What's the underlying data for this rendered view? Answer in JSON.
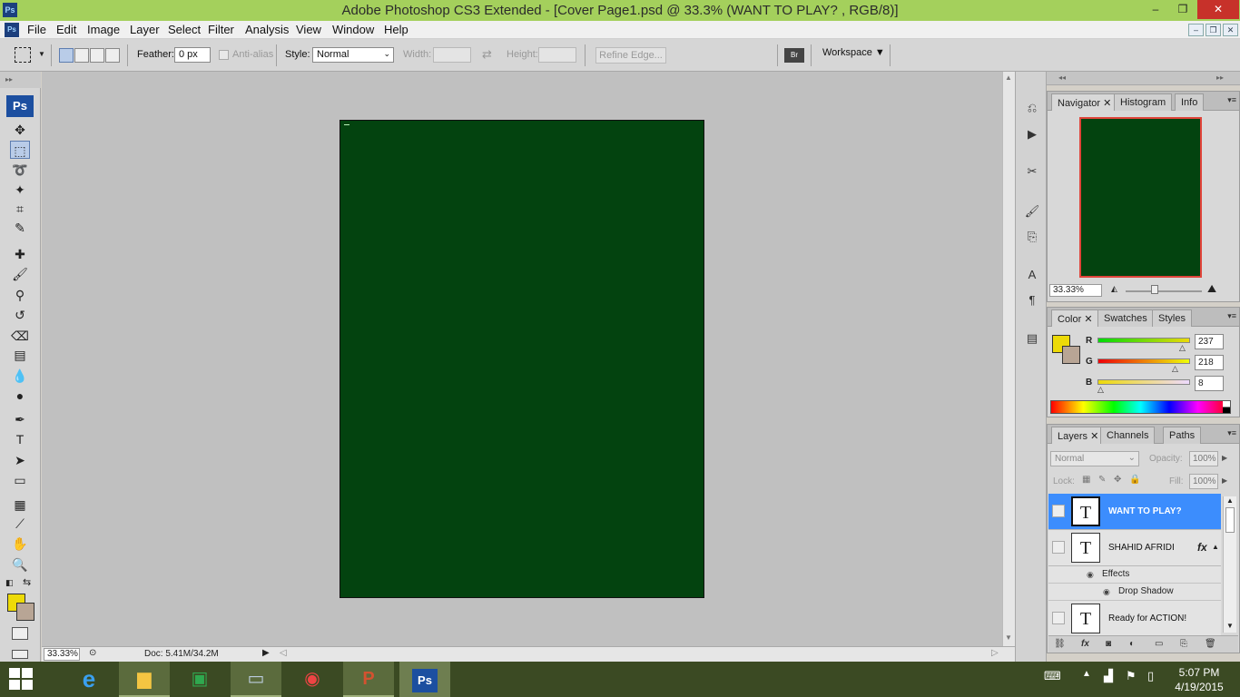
{
  "window": {
    "title": "Adobe Photoshop CS3 Extended - [Cover Page1.psd @ 33.3% (WANT TO PLAY? , RGB/8)]",
    "minimize_glyph": "–",
    "maximize_glyph": "❐",
    "close_glyph": "✕"
  },
  "menubar": {
    "items": [
      "File",
      "Edit",
      "Image",
      "Layer",
      "Select",
      "Filter",
      "Analysis",
      "View",
      "Window",
      "Help"
    ],
    "doc_controls": [
      "–",
      "❐",
      "✕"
    ]
  },
  "options_bar": {
    "feather_label": "Feather:",
    "feather_value": "0 px",
    "antialias_label": "Anti-alias",
    "style_label": "Style:",
    "style_value": "Normal",
    "width_label": "Width:",
    "height_label": "Height:",
    "refine_edge_label": "Refine Edge...",
    "workspace_label": "Workspace ▼"
  },
  "tools": {
    "logo": "Ps",
    "items": [
      {
        "name": "move-tool",
        "glyph": "✥"
      },
      {
        "name": "rectangular-marquee-tool",
        "glyph": "⬚"
      },
      {
        "name": "lasso-tool",
        "glyph": "➰"
      },
      {
        "name": "magic-wand-tool",
        "glyph": "✦"
      },
      {
        "name": "crop-tool",
        "glyph": "⌗"
      },
      {
        "name": "slice-tool",
        "glyph": "✎"
      },
      {
        "name": "healing-brush-tool",
        "glyph": "✚"
      },
      {
        "name": "brush-tool",
        "glyph": "🖌"
      },
      {
        "name": "clone-stamp-tool",
        "glyph": "⚲"
      },
      {
        "name": "history-brush-tool",
        "glyph": "↺"
      },
      {
        "name": "eraser-tool",
        "glyph": "⌫"
      },
      {
        "name": "gradient-tool",
        "glyph": "▤"
      },
      {
        "name": "blur-tool",
        "glyph": "💧"
      },
      {
        "name": "dodge-tool",
        "glyph": "●"
      },
      {
        "name": "pen-tool",
        "glyph": "✒"
      },
      {
        "name": "type-tool",
        "glyph": "T"
      },
      {
        "name": "path-selection-tool",
        "glyph": "➤"
      },
      {
        "name": "shape-tool",
        "glyph": "▭"
      },
      {
        "name": "notes-tool",
        "glyph": "▦"
      },
      {
        "name": "eyedropper-tool",
        "glyph": "⟋"
      },
      {
        "name": "hand-tool",
        "glyph": "✋"
      },
      {
        "name": "zoom-tool",
        "glyph": "🔍"
      }
    ],
    "fg_color": "#edda08",
    "bg_color": "#b8a595"
  },
  "document": {
    "fill_color": "#03430f"
  },
  "status_bar": {
    "zoom": "33.33%",
    "doc_info": "Doc: 5.41M/34.2M"
  },
  "navigator": {
    "tabs": [
      "Navigator",
      "Histogram",
      "Info"
    ],
    "zoom": "33.33%"
  },
  "color_panel": {
    "tabs": [
      "Color",
      "Swatches",
      "Styles"
    ],
    "channels": [
      {
        "label": "R",
        "value": "237"
      },
      {
        "label": "G",
        "value": "218"
      },
      {
        "label": "B",
        "value": "8"
      }
    ]
  },
  "layers_panel": {
    "tabs": [
      "Layers",
      "Channels",
      "Paths"
    ],
    "blend_mode": "Normal",
    "opacity_label": "Opacity:",
    "opacity_value": "100%",
    "lock_label": "Lock:",
    "fill_label": "Fill:",
    "fill_value": "100%",
    "layers": [
      {
        "name": "WANT TO PLAY?",
        "thumb": "T",
        "selected": true
      },
      {
        "name": "SHAHID AFRIDI",
        "thumb": "T",
        "fx": "fx"
      },
      {
        "name": "Ready for ACTION!",
        "thumb": "T"
      }
    ],
    "effects_label": "Effects",
    "drop_shadow_label": "Drop Shadow"
  },
  "taskbar": {
    "clock_time": "5:07 PM",
    "clock_date": "4/19/2015"
  }
}
